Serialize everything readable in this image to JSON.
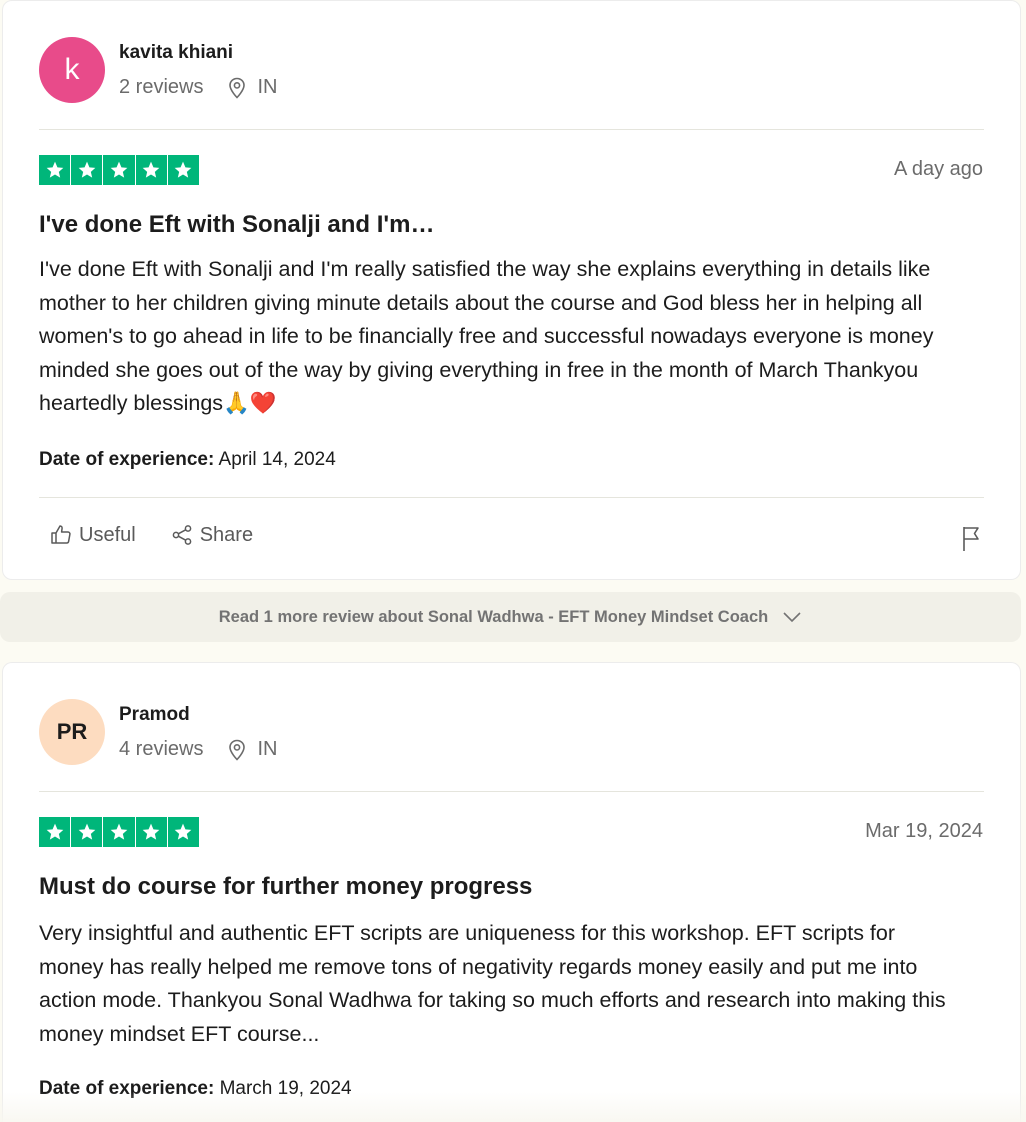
{
  "colors": {
    "star_green": "#00b67a",
    "avatar_pink": "#e84b8a",
    "avatar_peach": "#fddcc0",
    "page_bg": "#fcfbf3"
  },
  "reviews": [
    {
      "avatar_text": "k",
      "avatar_color": "#e84b8a",
      "name": "kavita khiani",
      "review_count": "2 reviews",
      "country": "IN",
      "rating": 5,
      "date": "A day ago",
      "title": "I've done Eft with Sonalji and I'm…",
      "text": "I've done Eft with Sonalji and I'm really satisfied the way she explains everything in details like mother to her children giving minute details about the course and God bless her in helping all women's to go ahead in life to be financially free and successful nowadays everyone is money minded she goes out of the way by giving everything in free in the month of March Thankyou heartedly blessings🙏❤️",
      "experience_label": "Date of experience:",
      "experience_date": "April 14, 2024",
      "useful_label": "Useful",
      "share_label": "Share"
    },
    {
      "avatar_text": "PR",
      "avatar_color": "#fddcc0",
      "name": "Pramod",
      "review_count": "4 reviews",
      "country": "IN",
      "rating": 5,
      "date": "Mar 19, 2024",
      "title": "Must do course for further money progress",
      "text": "Very insightful and authentic EFT scripts are uniqueness for this workshop. EFT scripts for money has really helped me remove tons of negativity regards money easily and put me into action mode. Thankyou Sonal Wadhwa for taking so much efforts and research into making this money mindset EFT course...",
      "experience_label": "Date of experience:",
      "experience_date": "March 19, 2024"
    }
  ],
  "more_reviews": {
    "label": "Read 1 more review about Sonal Wadhwa - EFT Money Mindset Coach"
  }
}
